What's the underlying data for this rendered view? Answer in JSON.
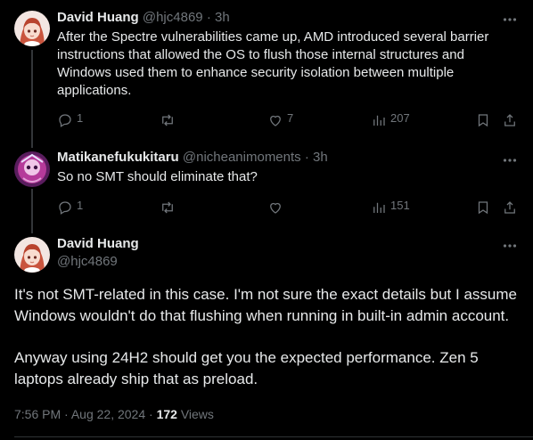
{
  "tweets": [
    {
      "name": "David Huang",
      "handle": "@hjc4869",
      "time": "3h",
      "text": "After the Spectre vulnerabilities came up, AMD introduced several barrier instructions that allowed the OS to flush those internal structures and Windows used them to enhance security isolation between multiple applications.",
      "replies": "1",
      "retweets": "",
      "likes": "7",
      "views": "207"
    },
    {
      "name": "Matikanefukukitaru",
      "handle": "@nicheanimoments",
      "time": "3h",
      "text": "So no SMT should eliminate that?",
      "replies": "1",
      "retweets": "",
      "likes": "",
      "views": "151"
    }
  ],
  "main": {
    "name": "David Huang",
    "handle": "@hjc4869",
    "paragraph1": "It's not SMT-related in this case. I'm not sure the exact details but I assume Windows wouldn't do that flushing when running in built-in admin account.",
    "paragraph2": "Anyway using 24H2 should get you the expected performance. Zen 5 laptops already ship that as preload.",
    "time": "7:56 PM",
    "date": "Aug 22, 2024",
    "views_count": "172",
    "views_label": "Views"
  },
  "separator": "·"
}
